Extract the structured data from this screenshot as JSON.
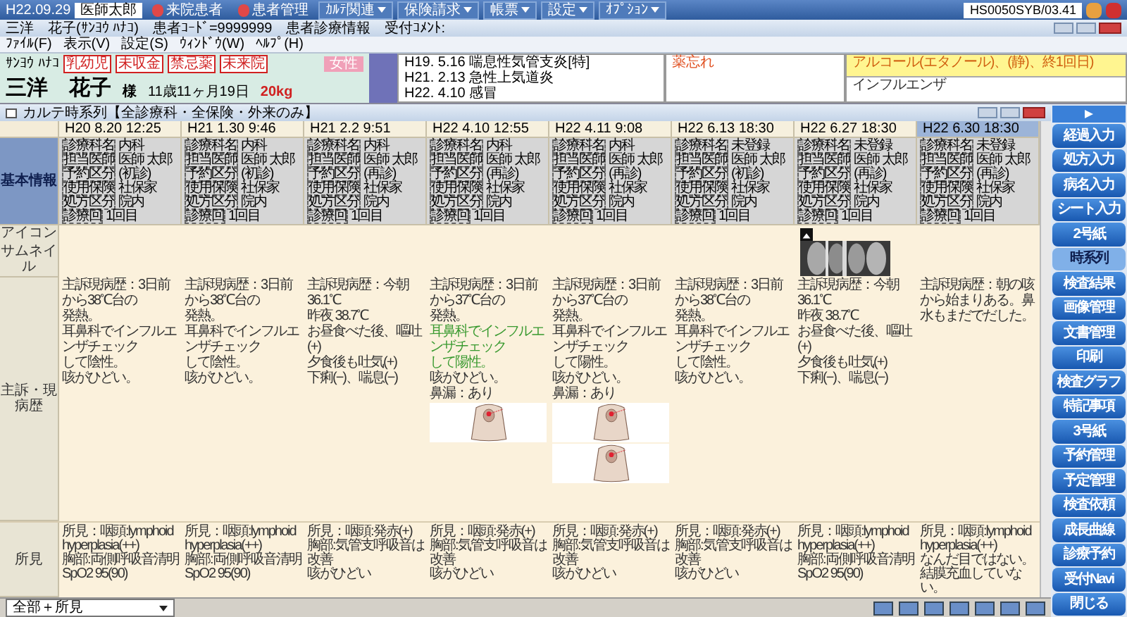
{
  "toolbar": {
    "date": "H22.09.29",
    "user": "医師太郎",
    "buttons": [
      {
        "label": "来院患者",
        "kind": "icon"
      },
      {
        "label": "患者管理",
        "kind": "icon"
      },
      {
        "label": "ｶﾙﾃ関連",
        "kind": "menu"
      },
      {
        "label": "保険請求",
        "kind": "menu"
      },
      {
        "label": "帳票",
        "kind": "menu"
      },
      {
        "label": "設定",
        "kind": "menu"
      },
      {
        "label": "ｵﾌﾟｼｮﾝ",
        "kind": "menu"
      }
    ],
    "version": "HS0050SYB/03.41"
  },
  "title_bar": {
    "title": "三洋　花子(ｻﾝﾖｳ ﾊﾅｺ)　患者ｺｰﾄﾞ=9999999　患者診療情報　受付ｺﾒﾝﾄ:"
  },
  "menu": [
    "ﾌｧｲﾙ(F)",
    "表示(V)",
    "設定(S)",
    "ｳｨﾝﾄﾞｳ(W)",
    "ﾍﾙﾌﾟ(H)"
  ],
  "patient": {
    "kana": "ｻﾝﾖｳ ﾊﾅｺ",
    "tags": [
      "乳幼児",
      "未収金",
      "禁忌薬",
      "未来院"
    ],
    "gender": "女性",
    "name": "三洋　花子",
    "honorific": "様",
    "age": "11歳11ヶ月19日",
    "weight": "20kg",
    "history": [
      "H19. 5.16 喘息性気管支炎[特]",
      "H21. 2.13 急性上気道炎",
      "H22. 4.10 感冒"
    ],
    "memo": "薬忘れ",
    "allergies": [
      {
        "text": "アルコール(エタノール)、(静)、終1回日)",
        "highlight": true
      },
      {
        "text": "インフルエンザ",
        "highlight": false
      }
    ]
  },
  "chart_window": {
    "title": "カルテ時系列【全診療科・全保険・外来のみ】"
  },
  "row_labels": [
    "基本情報",
    "アイコン",
    "サムネイル",
    "主訴・現病歴",
    "所見"
  ],
  "visits": [
    {
      "date": "H20 8.20 12:25",
      "selected": false,
      "info": [
        {
          "label": "診療科名",
          "value": "内科"
        },
        {
          "label": "担当医師",
          "value": "医師 太郎"
        },
        {
          "label": "予約区分",
          "value": "(初診)"
        },
        {
          "label": "使用保険",
          "value": "社保家"
        },
        {
          "label": "処方区分",
          "value": "院内"
        },
        {
          "label": "診療回",
          "value": "1回目"
        }
      ],
      "history": [
        {
          "text": "主訴現病歴：3日前から38℃台の",
          "kind": "normal"
        },
        {
          "text": "発熱。",
          "kind": "normal"
        },
        {
          "text": "耳鼻科でインフルエンザチェック",
          "kind": "normal"
        },
        {
          "text": "して陰性。",
          "kind": "normal"
        },
        {
          "text": "咳がひどい。",
          "kind": "normal"
        }
      ],
      "findings": [
        "所見：咽頭:lymphoid",
        "hyperplasia(++)",
        "胸部:両側呼吸音清明",
        "SpO2 95(90)"
      ]
    },
    {
      "date": "H21 1.30 9:46",
      "selected": false,
      "info": [
        {
          "label": "診療科名",
          "value": "内科"
        },
        {
          "label": "担当医師",
          "value": "医師 太郎"
        },
        {
          "label": "予約区分",
          "value": "(初診)"
        },
        {
          "label": "使用保険",
          "value": "社保家"
        },
        {
          "label": "処方区分",
          "value": "院内"
        },
        {
          "label": "診療回",
          "value": "1回目"
        }
      ],
      "history": [
        {
          "text": "主訴現病歴：3日前から38℃台の",
          "kind": "normal"
        },
        {
          "text": "発熱。",
          "kind": "normal"
        },
        {
          "text": "耳鼻科でインフルエンザチェック",
          "kind": "normal"
        },
        {
          "text": "して陰性。",
          "kind": "normal"
        },
        {
          "text": "咳がひどい。",
          "kind": "normal"
        }
      ],
      "findings": [
        "所見：咽頭:lymphoid",
        "hyperplasia(++)",
        "胸部:両側呼吸音清明",
        "SpO2 95(90)"
      ]
    },
    {
      "date": "H21 2.2 9:51",
      "selected": false,
      "info": [
        {
          "label": "診療科名",
          "value": "内科"
        },
        {
          "label": "担当医師",
          "value": "医師 太郎"
        },
        {
          "label": "予約区分",
          "value": "(再診)"
        },
        {
          "label": "使用保険",
          "value": "社保家"
        },
        {
          "label": "処方区分",
          "value": "院内"
        },
        {
          "label": "診療回",
          "value": "1回目"
        }
      ],
      "history": [
        {
          "text": "主訴現病歴：今朝 36.1℃",
          "kind": "normal"
        },
        {
          "text": "昨夜 38.7℃",
          "kind": "normal"
        },
        {
          "text": "お昼食べた後、嘔吐(+)",
          "kind": "normal"
        },
        {
          "text": "夕食後も吐気(+)",
          "kind": "normal"
        },
        {
          "text": "下痢(−)、喘息(−)",
          "kind": "normal"
        }
      ],
      "findings": [
        "所見：咽頭:発赤(+)",
        "胸部:気管支呼吸音は改善",
        "咳がひどい"
      ]
    },
    {
      "date": "H22 4.10 12:55",
      "selected": false,
      "info": [
        {
          "label": "診療科名",
          "value": "内科"
        },
        {
          "label": "担当医師",
          "value": "医師 太郎"
        },
        {
          "label": "予約区分",
          "value": "(再診)"
        },
        {
          "label": "使用保険",
          "value": "社保家"
        },
        {
          "label": "処方区分",
          "value": "院内"
        },
        {
          "label": "診療回",
          "value": "1回目"
        }
      ],
      "history": [
        {
          "text": "主訴現病歴：3日前から37℃台の",
          "kind": "normal"
        },
        {
          "text": "発熱。",
          "kind": "normal"
        },
        {
          "text": "耳鼻科でインフルエンザチェック",
          "kind": "highlight"
        },
        {
          "text": "して陽性。",
          "kind": "highlight"
        },
        {
          "text": "咳がひどい。",
          "kind": "normal"
        },
        {
          "text": "鼻漏：あり",
          "kind": "normal"
        }
      ],
      "drawings": [
        {
          "kind": "throat"
        }
      ],
      "findings": [
        "所見：咽頭:発赤(+)",
        "胸部:気管支呼吸音は改善",
        "咳がひどい"
      ]
    },
    {
      "date": "H22 4.11 9:08",
      "selected": false,
      "info": [
        {
          "label": "診療科名",
          "value": "内科"
        },
        {
          "label": "担当医師",
          "value": "医師 太郎"
        },
        {
          "label": "予約区分",
          "value": "(再診)"
        },
        {
          "label": "使用保険",
          "value": "社保家"
        },
        {
          "label": "処方区分",
          "value": "院内"
        },
        {
          "label": "診療回",
          "value": "1回目"
        }
      ],
      "history": [
        {
          "text": "主訴現病歴：3日前から37℃台の",
          "kind": "normal"
        },
        {
          "text": "発熱。",
          "kind": "normal"
        },
        {
          "text": "耳鼻科でインフルエンザチェック",
          "kind": "normal"
        },
        {
          "text": "して陽性。",
          "kind": "normal"
        },
        {
          "text": "咳がひどい。",
          "kind": "normal"
        },
        {
          "text": "鼻漏：あり",
          "kind": "normal"
        }
      ],
      "drawings": [
        {
          "kind": "throat"
        },
        {
          "kind": "throat"
        }
      ],
      "findings": [
        "所見：咽頭:発赤(+)",
        "胸部:気管支呼吸音は改善",
        "咳がひどい"
      ]
    },
    {
      "date": "H22 6.13 18:30",
      "selected": false,
      "info": [
        {
          "label": "診療科名",
          "value": "未登録"
        },
        {
          "label": "担当医師",
          "value": "医師 太郎"
        },
        {
          "label": "予約区分",
          "value": "(初診)"
        },
        {
          "label": "使用保険",
          "value": "社保家"
        },
        {
          "label": "処方区分",
          "value": "院内"
        },
        {
          "label": "診療回",
          "value": "1回目"
        }
      ],
      "history": [
        {
          "text": "主訴現病歴：3日前から38℃台の",
          "kind": "normal"
        },
        {
          "text": "発熱。",
          "kind": "normal"
        },
        {
          "text": "耳鼻科でインフルエンザチェック",
          "kind": "normal"
        },
        {
          "text": "して陰性。",
          "kind": "normal"
        },
        {
          "text": "咳がひどい。",
          "kind": "normal"
        }
      ],
      "findings": [
        "所見：咽頭:発赤(+)",
        "胸部:気管支呼吸音は改善",
        "咳がひどい"
      ]
    },
    {
      "date": "H22 6.27 18:30",
      "selected": false,
      "info": [
        {
          "label": "診療科名",
          "value": "未登録"
        },
        {
          "label": "担当医師",
          "value": "医師 太郎"
        },
        {
          "label": "予約区分",
          "value": "(再診)"
        },
        {
          "label": "使用保険",
          "value": "社保家"
        },
        {
          "label": "処方区分",
          "value": "院内"
        },
        {
          "label": "診療回",
          "value": "1回目"
        }
      ],
      "icon": true,
      "thumbnail": true,
      "history": [
        {
          "text": "主訴現病歴：今朝 36.1℃",
          "kind": "normal"
        },
        {
          "text": "昨夜 38.7℃",
          "kind": "normal"
        },
        {
          "text": "お昼食べた後、嘔吐(+)",
          "kind": "normal"
        },
        {
          "text": "夕食後も吐気(+)",
          "kind": "normal"
        },
        {
          "text": "下痢(−)、喘息(−)",
          "kind": "normal"
        }
      ],
      "findings": [
        "所見：咽頭:lymphoid",
        "hyperplasia(++)",
        "胸部:両側呼吸音清明",
        "SpO2 95(90)"
      ]
    },
    {
      "date": "H22 6.30 18:30",
      "selected": true,
      "info": [
        {
          "label": "診療科名",
          "value": "未登録"
        },
        {
          "label": "担当医師",
          "value": "医師 太郎"
        },
        {
          "label": "予約区分",
          "value": "(再診)"
        },
        {
          "label": "使用保険",
          "value": "社保家"
        },
        {
          "label": "処方区分",
          "value": "院内"
        },
        {
          "label": "診療回",
          "value": "1回目"
        }
      ],
      "history": [
        {
          "text": "主訴現病歴：朝の咳から始まりある。鼻水もまだでだした。",
          "kind": "normal"
        }
      ],
      "findings": [
        "所見：咽頭:lymphoid",
        "hyperplasia(++)",
        "なんだ目ではない。",
        "結膜充血していない。"
      ]
    }
  ],
  "sidebar": [
    {
      "label": "経過入力",
      "selected": false
    },
    {
      "label": "処方入力",
      "selected": false
    },
    {
      "label": "病名入力",
      "selected": false
    },
    {
      "label": "シート入力",
      "selected": false
    },
    {
      "label": "2号紙",
      "selected": false
    },
    {
      "label": "時系列",
      "selected": true
    },
    {
      "label": "検査結果",
      "selected": false
    },
    {
      "label": "画像管理",
      "selected": false
    },
    {
      "label": "文書管理",
      "selected": false
    },
    {
      "label": "印刷",
      "selected": false
    },
    {
      "label": "検査グラフ",
      "selected": false
    },
    {
      "label": "特記事項",
      "selected": false
    },
    {
      "label": "3号紙",
      "selected": false
    },
    {
      "label": "予約管理",
      "selected": false
    },
    {
      "label": "予定管理",
      "selected": false
    },
    {
      "label": "検査依頼",
      "selected": false
    },
    {
      "label": "成長曲線",
      "selected": false
    },
    {
      "label": "診療予約",
      "selected": false
    },
    {
      "label": "受付Navi",
      "selected": false
    },
    {
      "label": "閉じる",
      "selected": false
    }
  ],
  "view_select": {
    "value": "全部＋所見"
  }
}
